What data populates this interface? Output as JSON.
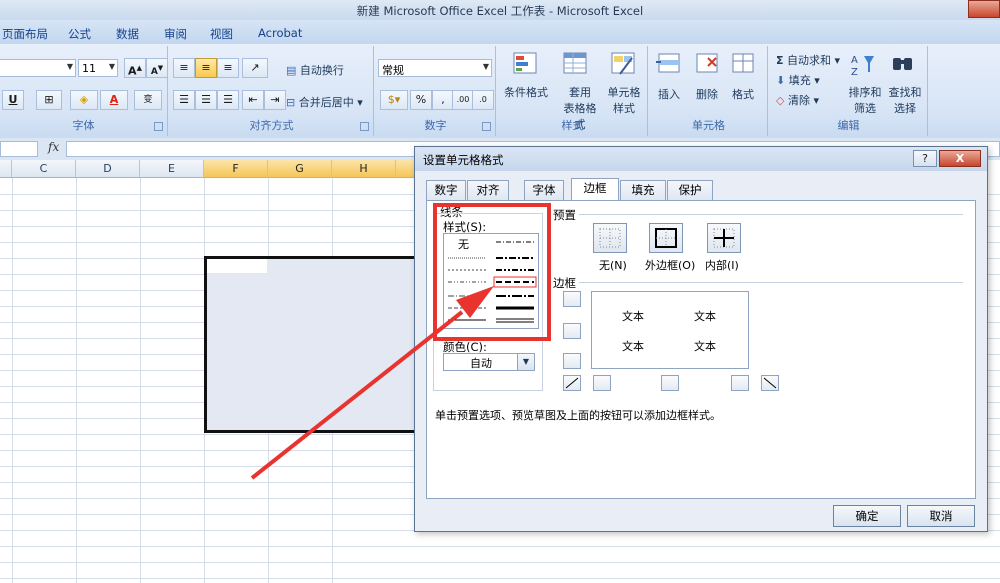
{
  "window": {
    "title": "新建 Microsoft Office Excel 工作表 - Microsoft Excel"
  },
  "menu_tabs": [
    "页面布局",
    "公式",
    "数据",
    "审阅",
    "视图",
    "Acrobat"
  ],
  "ribbon": {
    "font_size": "11",
    "number_format": "常规",
    "wrap_text": "自动换行",
    "merge_center": "合并后居中",
    "conditional_format": [
      "条件格式"
    ],
    "format_as_table": [
      "套用",
      "表格格式"
    ],
    "cell_styles": [
      "单元格",
      "样式"
    ],
    "insert": "插入",
    "delete": "删除",
    "format": "格式",
    "autosum": "自动求和",
    "fill": "填充",
    "clear": "清除",
    "sort_filter": [
      "排序和",
      "筛选"
    ],
    "find_select": [
      "查找和",
      "选择"
    ],
    "group_labels": {
      "font": "字体",
      "alignment": "对齐方式",
      "number": "数字",
      "styles": "样式",
      "cells": "单元格",
      "editing": "编辑"
    }
  },
  "formula_bar": {
    "fx": "fx",
    "value": ""
  },
  "columns": [
    "C",
    "D",
    "E",
    "F",
    "G",
    "H"
  ],
  "dialog": {
    "title": "设置单元格格式",
    "help": "?",
    "close": "X",
    "tabs": [
      "数字",
      "对齐",
      "字体",
      "边框",
      "填充",
      "保护"
    ],
    "active_tab": "边框",
    "line_section": "线条",
    "style_label": "样式(S):",
    "style_none": "无",
    "color_label": "颜色(C):",
    "color_value": "自动",
    "presets_label": "预置",
    "preset_buttons": [
      "无(N)",
      "外边框(O)",
      "内部(I)"
    ],
    "border_label": "边框",
    "preview_text": [
      "文本",
      "文本",
      "文本",
      "文本"
    ],
    "hint": "单击预置选项、预览草图及上面的按钮可以添加边框样式。",
    "ok": "确定",
    "cancel": "取消"
  },
  "colors": {
    "annotation": "#e8332e",
    "selection_fill": "#e3e8f3",
    "active_header": "#f5c55a"
  }
}
